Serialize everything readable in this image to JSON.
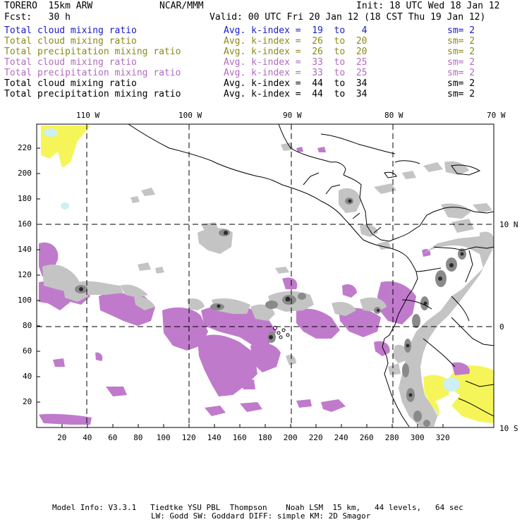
{
  "header": {
    "model": "TORERO  15km ARW",
    "org": "NCAR/MMM",
    "init": "Init: 18 UTC Wed 18 Jan 12",
    "fcst": "Fcst:   30 h",
    "valid": "Valid: 00 UTC Fri 20 Jan 12 (18 CST Thu 19 Jan 12)"
  },
  "legend": [
    {
      "name": "Total cloud mixing ratio",
      "kindex": "Avg. k-index =  19  to   4",
      "sm": "sm= 2",
      "color": "#1a1acc"
    },
    {
      "name": "Total cloud mixing ratio",
      "kindex": "Avg. k-index =  26  to  20",
      "sm": "sm= 2",
      "color": "#8a8a1a"
    },
    {
      "name": "Total precipitation mixing ratio",
      "kindex": "Avg. k-index =  26  to  20",
      "sm": "sm= 2",
      "color": "#8a8a1a"
    },
    {
      "name": "Total cloud mixing ratio",
      "kindex": "Avg. k-index =  33  to  25",
      "sm": "sm= 2",
      "color": "#b26bbf"
    },
    {
      "name": "Total precipitation mixing ratio",
      "kindex": "Avg. k-index =  33  to  25",
      "sm": "sm= 2",
      "color": "#b26bbf"
    },
    {
      "name": "Total cloud mixing ratio",
      "kindex": "Avg. k-index =  44  to  34",
      "sm": "sm= 2",
      "color": "#000000"
    },
    {
      "name": "Total precipitation mixing ratio",
      "kindex": "Avg. k-index =  44  to  34",
      "sm": "sm= 2",
      "color": "#000000"
    }
  ],
  "map": {
    "top_labels": [
      "110 W",
      "100 W",
      "90 W",
      "80 W",
      "70 W"
    ],
    "right_labels": [
      "10 N",
      "0",
      "10 S"
    ],
    "x_ticks": [
      20,
      40,
      60,
      80,
      100,
      120,
      140,
      160,
      180,
      200,
      220,
      240,
      260,
      280,
      300,
      320
    ],
    "y_ticks": [
      20,
      40,
      60,
      80,
      100,
      120,
      140,
      160,
      180,
      200,
      220
    ],
    "colors": {
      "purple": "#c07acc",
      "yellow": "#f5f55a",
      "gray_light": "#c8c8c8",
      "gray_mid": "#9a9a9a",
      "gray_dark": "#3a3a3a",
      "cyan": "#cdeff5"
    }
  },
  "footer": {
    "line1": "Model Info: V3.3.1   Tiedtke YSU PBL  Thompson    Noah LSM  15 km,   44 levels,   64 sec",
    "line2": "LW: Godd SW: Goddard DIFF: simple KM: 2D Smagor"
  }
}
